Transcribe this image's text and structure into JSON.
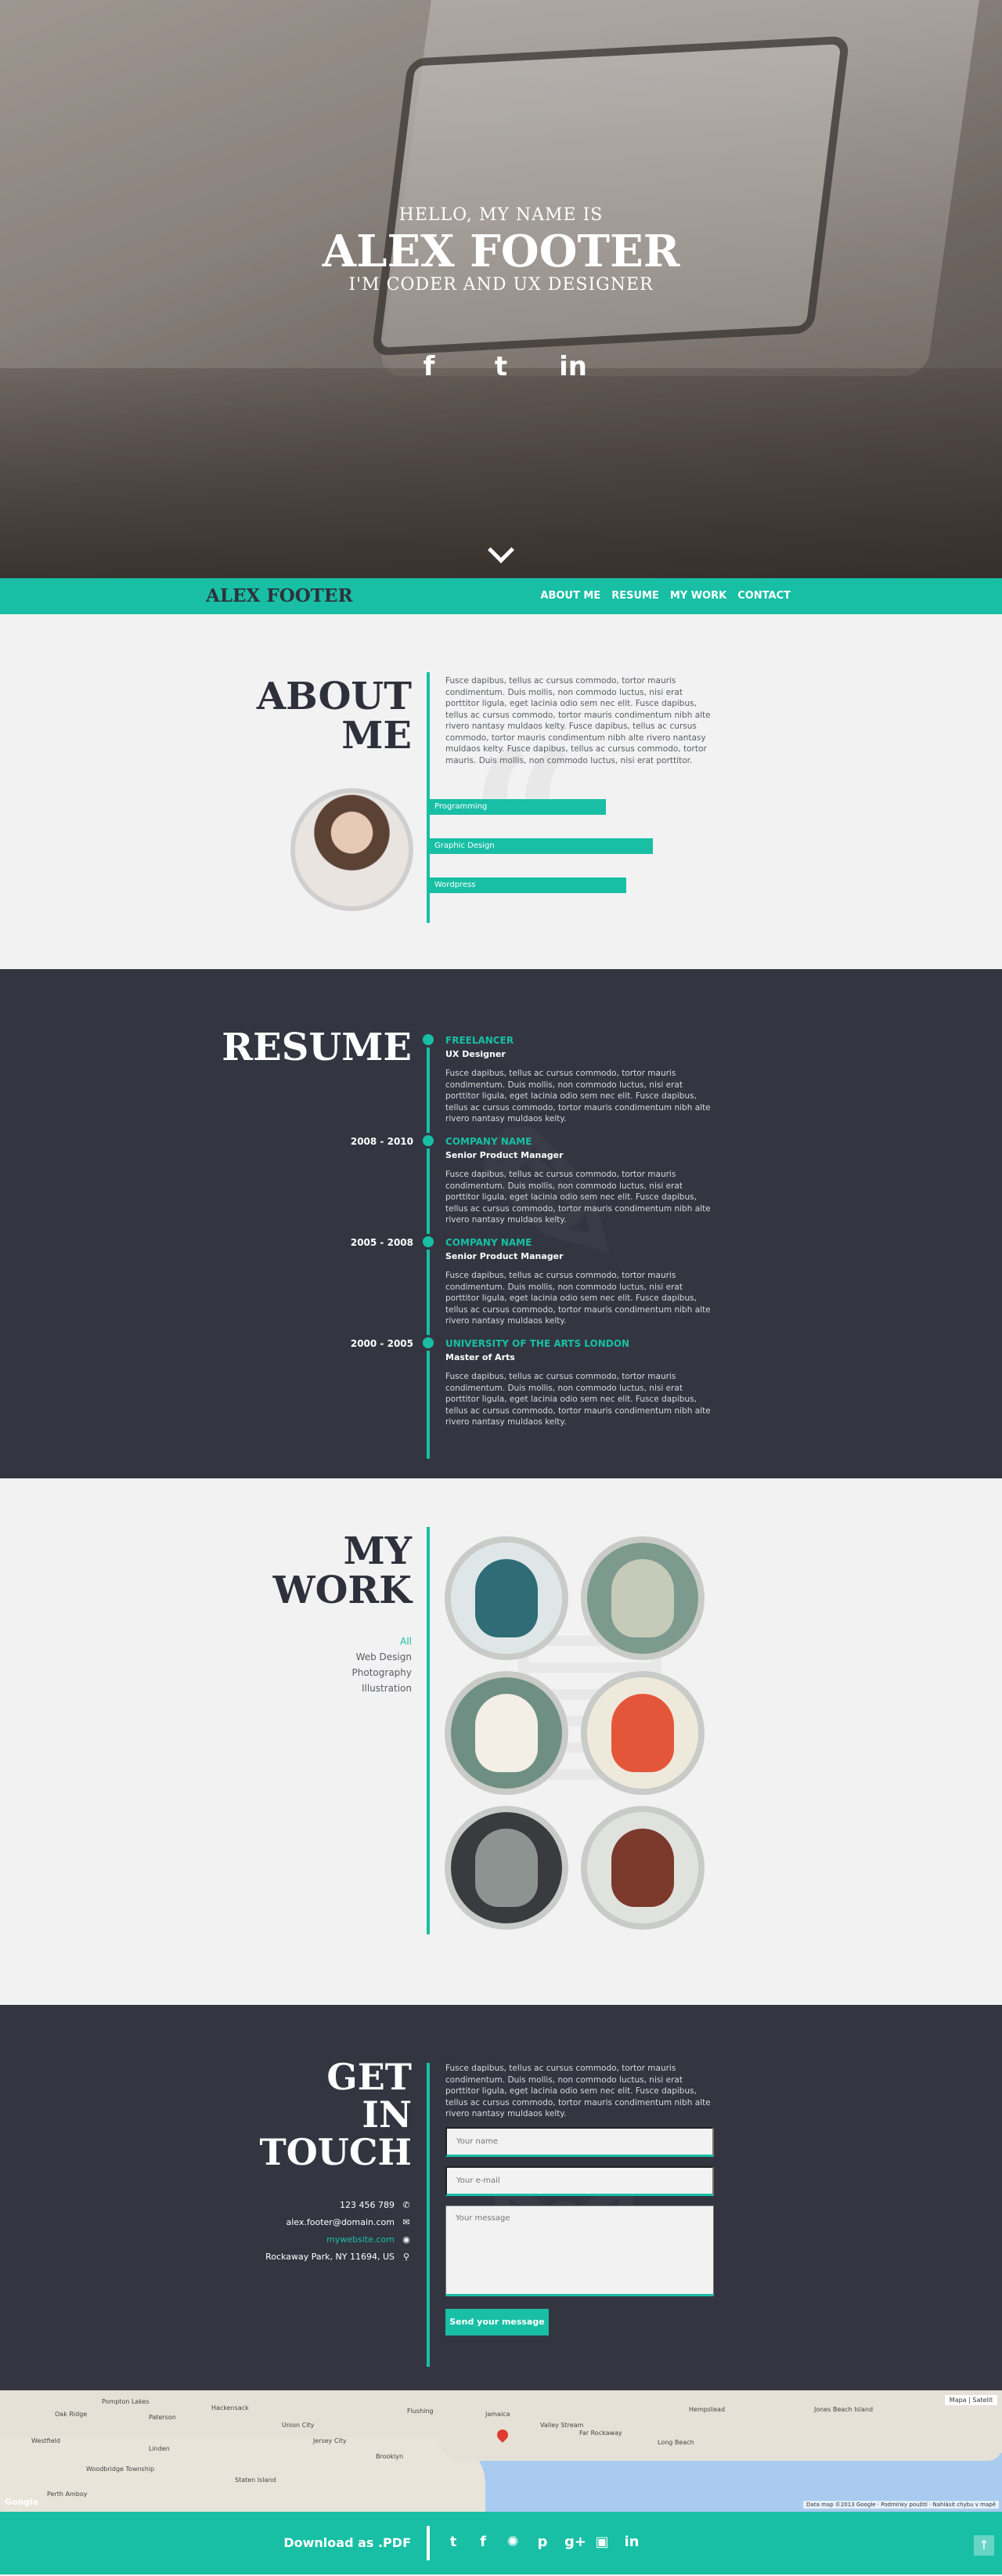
{
  "hero": {
    "greeting": "HELLO, MY NAME IS",
    "name": "ALEX FOOTER",
    "role": "I'M CODER AND UX DESIGNER",
    "social_icons": [
      "facebook-icon",
      "twitter-icon",
      "linkedin-icon"
    ],
    "social_glyphs": [
      "f",
      "t",
      "in"
    ]
  },
  "nav": {
    "brand": "ALEX FOOTER",
    "links": [
      "ABOUT ME",
      "RESUME",
      "MY WORK",
      "CONTACT"
    ]
  },
  "about": {
    "heading_line1": "ABOUT",
    "heading_line2": "ME",
    "text": "Fusce dapibus, tellus ac cursus commodo, tortor mauris condimentum. Duis mollis, non commodo luctus, nisi erat porttitor ligula, eget lacinia odio sem nec elit. Fusce dapibus, tellus ac cursus commodo, tortor mauris condimentum nibh alte rivero nantasy muldaos kelty. Fusce dapibus, tellus ac cursus commodo, tortor mauris condimentum nibh alte rivero nantasy muldaos kelty. Fusce dapibus, tellus ac cursus commodo, tortor mauris. Duis mollis, non commodo luctus, nisi erat porttitor.",
    "skills": [
      {
        "label": "Programming",
        "level": 0.76
      },
      {
        "label": "Graphic Design",
        "level": 0.95
      },
      {
        "label": "Wordpress",
        "level": 0.8
      }
    ]
  },
  "resume": {
    "heading": "RESUME",
    "jobs": [
      {
        "dates": "",
        "company": "FREELANCER",
        "title": "UX Designer",
        "text": "Fusce dapibus, tellus ac cursus commodo, tortor mauris condimentum. Duis mollis, non commodo luctus, nisi erat porttitor ligula, eget lacinia odio sem nec elit. Fusce dapibus, tellus ac cursus commodo, tortor mauris condimentum nibh alte rivero nantasy muldaos kelty."
      },
      {
        "dates": "2008 - 2010",
        "company": "COMPANY NAME",
        "title": "Senior Product Manager",
        "text": "Fusce dapibus, tellus ac cursus commodo, tortor mauris condimentum. Duis mollis, non commodo luctus, nisi erat porttitor ligula, eget lacinia odio sem nec elit. Fusce dapibus, tellus ac cursus commodo, tortor mauris condimentum nibh alte rivero nantasy muldaos kelty."
      },
      {
        "dates": "2005 - 2008",
        "company": "COMPANY NAME",
        "title": "Senior Product Manager",
        "text": "Fusce dapibus, tellus ac cursus commodo, tortor mauris condimentum. Duis mollis, non commodo luctus, nisi erat porttitor ligula, eget lacinia odio sem nec elit. Fusce dapibus, tellus ac cursus commodo, tortor mauris condimentum nibh alte rivero nantasy muldaos kelty."
      },
      {
        "dates": "2000 - 2005",
        "company": "UNIVERSITY OF THE ARTS LONDON",
        "title": "Master of Arts",
        "text": "Fusce dapibus, tellus ac cursus commodo, tortor mauris condimentum. Duis mollis, non commodo luctus, nisi erat porttitor ligula, eget lacinia odio sem nec elit. Fusce dapibus, tellus ac cursus commodo, tortor mauris condimentum nibh alte rivero nantasy muldaos kelty."
      }
    ]
  },
  "work": {
    "heading_line1": "MY",
    "heading_line2": "WORK",
    "filters": [
      "All",
      "Web Design",
      "Photography",
      "Illustration"
    ],
    "thumbs": [
      {
        "name": "whale-illustration",
        "bg": "#dfe6e7",
        "fig": "#2f6c75"
      },
      {
        "name": "rabbit-illustration",
        "bg": "#7c9a8e",
        "fig": "#c6cab8"
      },
      {
        "name": "cow-illustration",
        "bg": "#6f8f84",
        "fig": "#f3efe6"
      },
      {
        "name": "carrot-illustration",
        "bg": "#efe9db",
        "fig": "#e4563a"
      },
      {
        "name": "donkey-illustration",
        "bg": "#3a3b3e",
        "fig": "#8c9390"
      },
      {
        "name": "meat-illustration",
        "bg": "#e0e2dd",
        "fig": "#7b3a2c"
      }
    ]
  },
  "contact": {
    "heading_line1": "GET",
    "heading_line2": "IN",
    "heading_line3": "TOUCH",
    "text": "Fusce dapibus, tellus ac cursus commodo, tortor mauris condimentum. Duis mollis, non commodo luctus, nisi erat porttitor ligula, eget lacinia odio sem nec elit. Fusce dapibus, tellus ac cursus commodo, tortor mauris condimentum nibh alte rivero nantasy muldaos kelty.",
    "phone": "123 456 789",
    "email": "alex.footer@domain.com",
    "website": "mywebsite.com",
    "address": "Rockaway Park, NY 11694, US",
    "name_placeholder": "Your name",
    "email_placeholder": "Your e-mail",
    "message_placeholder": "Your message",
    "send_label": "Send your message"
  },
  "map": {
    "labels": [
      "Oak Ridge",
      "Pompton Lakes",
      "Paterson",
      "Hackensack",
      "Flushing",
      "Jamaica",
      "Valley Stream",
      "Far Rockaway",
      "Long Beach",
      "Jones Beach Island",
      "Woodbridge Township",
      "Union City",
      "Linden",
      "Jersey City",
      "Brooklyn",
      "Staten Island",
      "Westfield",
      "Perth Amboy",
      "Hempstead"
    ],
    "map_type": "Mapa",
    "satellite": "Satelit",
    "attribution": "Data map ©2013 Google · Podmínky použití · Nahlásit chybu v mapě",
    "logo": "Google"
  },
  "footer": {
    "download": "Download as .PDF",
    "icons": [
      "twitter-icon",
      "facebook-icon",
      "dribbble-icon",
      "pinterest-icon",
      "googleplus-icon",
      "instagram-icon",
      "linkedin-icon"
    ],
    "glyphs": [
      "t",
      "f",
      "✺",
      "p",
      "g+",
      "▣",
      "in"
    ],
    "scroll_top": "↑"
  }
}
